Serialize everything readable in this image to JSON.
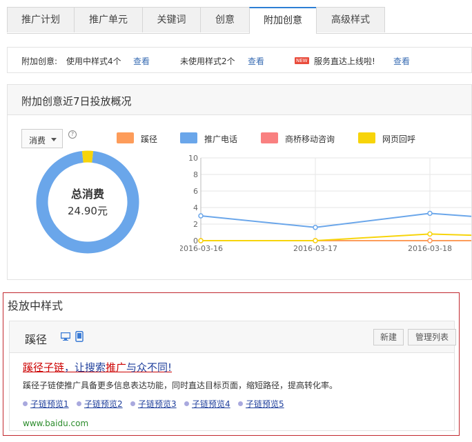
{
  "tabs": [
    {
      "label": "推广计划"
    },
    {
      "label": "推广单元"
    },
    {
      "label": "关键词"
    },
    {
      "label": "创意"
    },
    {
      "label": "附加创意",
      "active": true
    },
    {
      "label": "高级样式"
    }
  ],
  "infobar": {
    "in_use_label": "附加创意:",
    "in_use_text": "使用中样式4个",
    "view1": "查看",
    "unused_text": "未使用样式2个",
    "view2": "查看",
    "new_badge": "NEW",
    "service_text": "服务直达上线啦!",
    "view3": "查看"
  },
  "overview": {
    "title": "附加创意近7日投放概况",
    "metric_select": "消费",
    "help_icon": "question-circle-icon",
    "total_label": "总消费",
    "total_value": "24.90元"
  },
  "legend": [
    {
      "name": "蹊径",
      "color": "#fd9c5a"
    },
    {
      "name": "推广电话",
      "color": "#6aa6ea"
    },
    {
      "name": "商桥移动咨询",
      "color": "#f98080"
    },
    {
      "name": "网页回呼",
      "color": "#f7d40a"
    }
  ],
  "chart_data": {
    "type": "line",
    "x": [
      "2016-03-16",
      "2016-03-17",
      "2016-03-18",
      ""
    ],
    "ylim": [
      0,
      10
    ],
    "yticks": [
      "0",
      "2",
      "4",
      "6",
      "8",
      "10"
    ],
    "series": [
      {
        "name": "蹊径",
        "color": "#fd9c5a",
        "values": [
          0,
          0,
          0,
          0
        ]
      },
      {
        "name": "推广电话",
        "color": "#6aa6ea",
        "values": [
          3.0,
          1.6,
          3.3,
          2.3
        ]
      },
      {
        "name": "商桥移动咨询",
        "color": "#f98080",
        "values": [
          0,
          0,
          0,
          0
        ]
      },
      {
        "name": "网页回呼",
        "color": "#f7d40a",
        "values": [
          0,
          0,
          0.8,
          0.4
        ]
      }
    ],
    "donut": {
      "type": "pie",
      "slices": [
        {
          "name": "推广电话",
          "value": 96.5,
          "color": "#6aa6ea"
        },
        {
          "name": "网页回呼",
          "value": 3.5,
          "color": "#f7d40a"
        }
      ]
    }
  },
  "active": {
    "title": "投放中样式",
    "card_name": "蹊径",
    "new_btn": "新建",
    "manage_btn": "管理列表",
    "ad_title_a": "蹊径子链",
    "ad_title_b": "，让搜索",
    "ad_title_c": "推广",
    "ad_title_d": "与众不同!",
    "ad_desc": "蹊径子链使推广具备更多信息表达功能，同时直达目标页面，缩短路径，提高转化率。",
    "sublinks": [
      "子链预览1",
      "子链预览2",
      "子链预览3",
      "子链预览4",
      "子链预览5"
    ],
    "url": "www.baidu.com"
  }
}
